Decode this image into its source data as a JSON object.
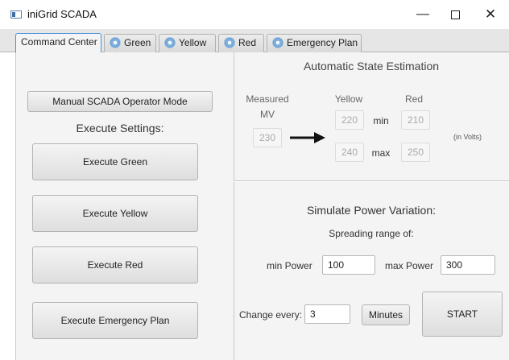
{
  "window": {
    "title": "iniGrid SCADA",
    "minimize_glyph": "—",
    "close_glyph": "✕"
  },
  "tabs": [
    {
      "label": "Command Center",
      "active": true
    },
    {
      "label": "Green",
      "icon": "gear-icon"
    },
    {
      "label": "Yellow",
      "icon": "gear-icon"
    },
    {
      "label": "Red",
      "icon": "gear-icon"
    },
    {
      "label": "Emergency Plan",
      "icon": "gear-icon"
    }
  ],
  "left": {
    "manual_mode_label": "Manual  SCADA Operator Mode",
    "execute_settings_label": "Execute Settings:",
    "buttons": {
      "green": "Execute Green",
      "yellow": "Execute Yellow",
      "red": "Execute Red",
      "emergency": "Execute Emergency Plan"
    }
  },
  "state_estimation": {
    "title": "Automatic State Estimation",
    "measured_label_1": "Measured",
    "measured_label_2": "MV",
    "measured_value": "230",
    "yellow_label": "Yellow",
    "red_label": "Red",
    "min_label": "min",
    "max_label": "max",
    "yellow_min": "220",
    "yellow_max": "240",
    "red_min": "210",
    "red_max": "250",
    "units": "(in Volts)"
  },
  "simulate": {
    "title": "Simulate Power Variation:",
    "subtitle": "Spreading range of:",
    "min_power_label": "min Power",
    "min_power_value": "100",
    "max_power_label": "max Power",
    "max_power_value": "300",
    "change_every_label": "Change every:",
    "change_every_value": "3",
    "minutes_label": "Minutes",
    "start_label": "START"
  }
}
